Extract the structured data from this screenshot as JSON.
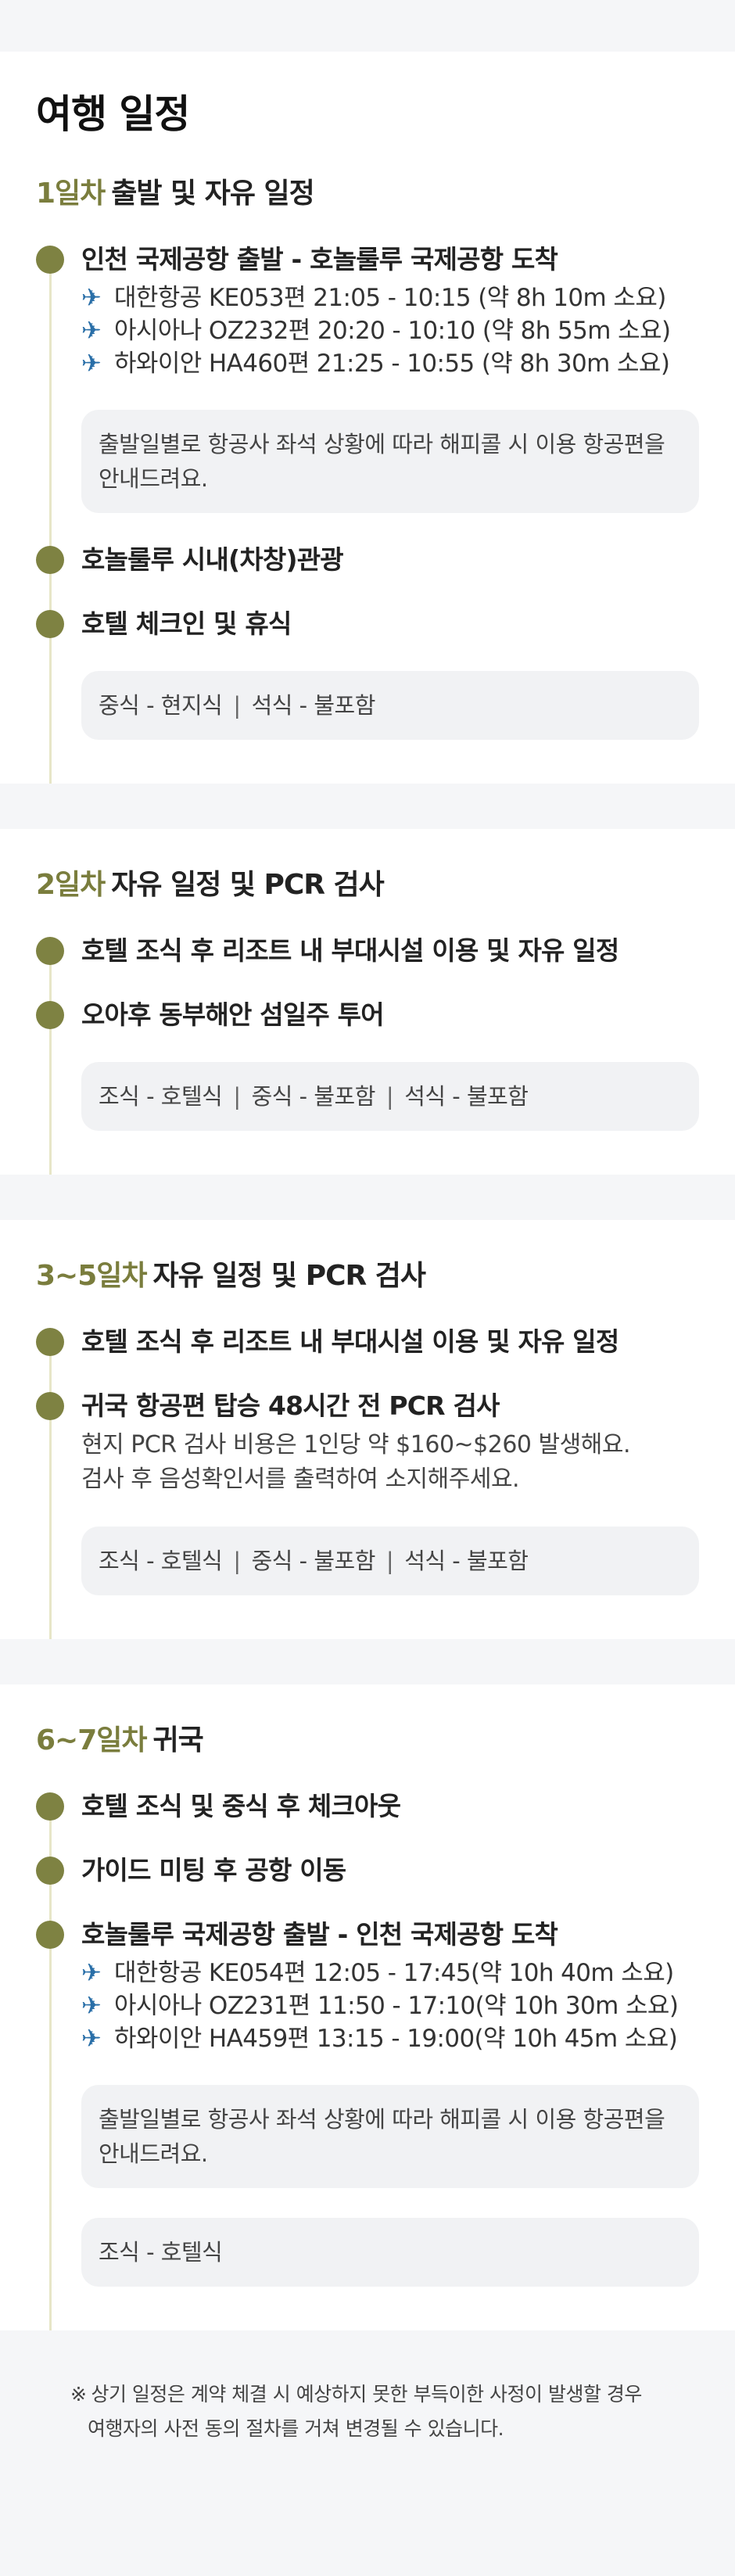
{
  "page_title": "여행 일정",
  "days": [
    {
      "daynum": "1일차",
      "title": "출발 및 자유 일정",
      "items": [
        {
          "title": "인천 국제공항 출발 - 호놀룰루 국제공항 도착",
          "flights": [
            "대한항공 KE053편 21:05 - 10:15 (약 8h 10m 소요)",
            "아시아나 OZ232편 20:20 - 10:10 (약 8h 55m 소요)",
            "하와이안 HA460편 21:25 - 10:55 (약 8h 30m 소요)"
          ],
          "note_lines": [
            "출발일별로 항공사 좌석 상황에 따라 해피콜 시 이용 항공편을",
            "안내드려요."
          ]
        },
        {
          "title": "호놀룰루 시내(차창)관광"
        },
        {
          "title": "호텔 체크인 및 휴식"
        }
      ],
      "meals": [
        "중식 - 현지식",
        "석식 - 불포함"
      ]
    },
    {
      "daynum": "2일차",
      "title": "자유 일정 및 PCR 검사",
      "items": [
        {
          "title": "호텔 조식 후 리조트 내 부대시설 이용 및 자유 일정"
        },
        {
          "title": "오아후 동부해안 섬일주 투어"
        }
      ],
      "meals": [
        "조식 - 호텔식",
        "중식 - 불포함",
        "석식 - 불포함"
      ]
    },
    {
      "daynum": "3~5일차",
      "title": "자유 일정 및 PCR 검사",
      "items": [
        {
          "title": "호텔 조식 후 리조트 내 부대시설 이용 및 자유 일정"
        },
        {
          "title": "귀국 항공편 탑승 48시간 전 PCR 검사",
          "desc_lines": [
            "현지 PCR 검사 비용은 1인당 약 $160~$260 발생해요.",
            "검사 후 음성확인서를 출력하여 소지해주세요."
          ]
        }
      ],
      "meals": [
        "조식 - 호텔식",
        "중식 - 불포함",
        "석식 - 불포함"
      ]
    },
    {
      "daynum": "6~7일차",
      "title": "귀국",
      "items": [
        {
          "title": "호텔 조식 및 중식 후 체크아웃"
        },
        {
          "title": "가이드 미팅 후 공항 이동"
        },
        {
          "title": "호놀룰루 국제공항 출발 - 인천 국제공항 도착",
          "flights": [
            "대한항공 KE054편 12:05 - 17:45(약 10h 40m 소요)",
            "아시아나 OZ231편 11:50 - 17:10(약 10h 30m 소요)",
            "하와이안 HA459편 13:15 - 19:00(약 10h 45m 소요)"
          ],
          "note_lines": [
            "출발일별로 항공사 좌석 상황에 따라 해피콜 시 이용 항공편을",
            "안내드려요."
          ]
        }
      ],
      "meals": [
        "조식 - 호텔식"
      ]
    }
  ],
  "footer": {
    "mark": "※",
    "lines": [
      "상기 일정은 계약 체결 시 예상하지 못한 부득이한 사정이 발생할 경우",
      "여행자의 사전 동의 절차를 거쳐 변경될 수 있습니다."
    ]
  },
  "icons": {
    "flight": "airplane-icon"
  },
  "colors": {
    "accent": "#7e8242",
    "accent_text": "#7a7d3d",
    "timeline_line": "#e7e6c8",
    "box_bg": "#f1f2f4"
  }
}
